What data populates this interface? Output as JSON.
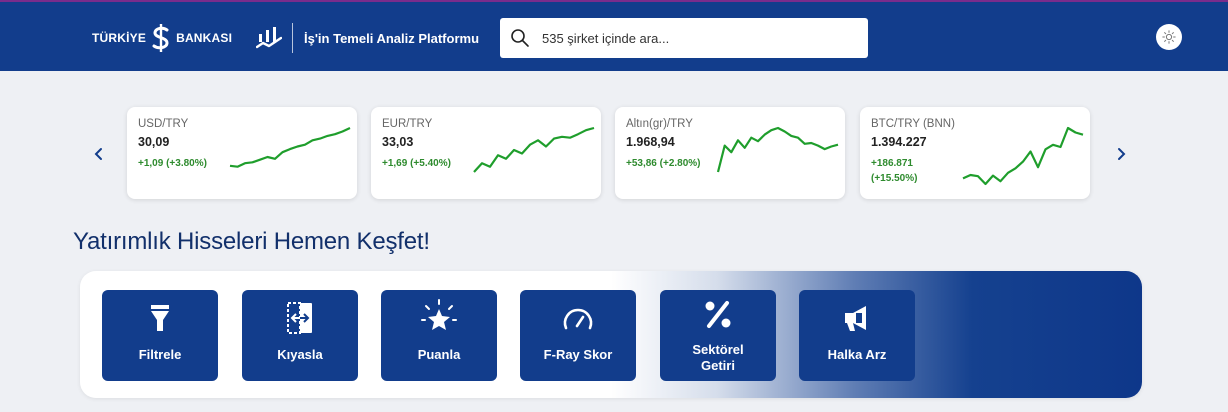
{
  "header": {
    "bank_left": "TÜRKİYE",
    "bank_right": "BANKASI",
    "platform_name": "İş'in Temeli Analiz Platformu",
    "search_placeholder": "535 şirket içinde ara...",
    "theme_icon": "sun-icon"
  },
  "tickers": [
    {
      "name": "USD/TRY",
      "price": "30,09",
      "change": "+1,09 (+3.80%)",
      "trend": [
        0.14,
        0.12,
        0.2,
        0.22,
        0.28,
        0.34,
        0.3,
        0.45,
        0.52,
        0.58,
        0.62,
        0.72,
        0.76,
        0.82,
        0.86,
        0.92,
        1.0
      ],
      "color": "#1f9e2c"
    },
    {
      "name": "EUR/TRY",
      "price": "33,03",
      "change": "+1,69 (+5.40%)",
      "trend": [
        0.0,
        0.2,
        0.12,
        0.38,
        0.3,
        0.5,
        0.42,
        0.62,
        0.72,
        0.58,
        0.76,
        0.8,
        0.78,
        0.86,
        0.95,
        1.0
      ],
      "color": "#1f9e2c"
    },
    {
      "name": "Altın(gr)/TRY",
      "price": "1.968,94",
      "change": "+53,86 (+2.80%)",
      "trend": [
        0.0,
        0.6,
        0.45,
        0.72,
        0.55,
        0.78,
        0.7,
        0.85,
        0.95,
        1.0,
        0.92,
        0.82,
        0.78,
        0.64,
        0.66,
        0.6,
        0.52,
        0.58,
        0.62
      ],
      "color": "#1f9e2c"
    },
    {
      "name": "BTC/TRY (BNN)",
      "price": "1.394.227",
      "change": "+186.871 (+15.50%)",
      "trend": [
        0.1,
        0.16,
        0.14,
        0.0,
        0.15,
        0.05,
        0.2,
        0.28,
        0.4,
        0.58,
        0.3,
        0.62,
        0.7,
        0.66,
        1.0,
        0.92,
        0.88
      ],
      "color": "#1f9e2c"
    }
  ],
  "section": {
    "title": "Yatırımlık Hisseleri Hemen Keşfet!"
  },
  "tools": [
    {
      "label": "Filtrele",
      "icon": "filter-icon"
    },
    {
      "label": "Kıyasla",
      "icon": "compare-icon"
    },
    {
      "label": "Puanla",
      "icon": "star-rating-icon"
    },
    {
      "label": "F-Ray Skor",
      "icon": "gauge-icon"
    },
    {
      "label": "Sektörel Getiri",
      "icon": "percent-icon"
    },
    {
      "label": "Halka Arz",
      "icon": "megaphone-icon"
    }
  ],
  "colors": {
    "brand": "#123d8c",
    "positive": "#1f9e2c",
    "heading": "#12306b"
  }
}
